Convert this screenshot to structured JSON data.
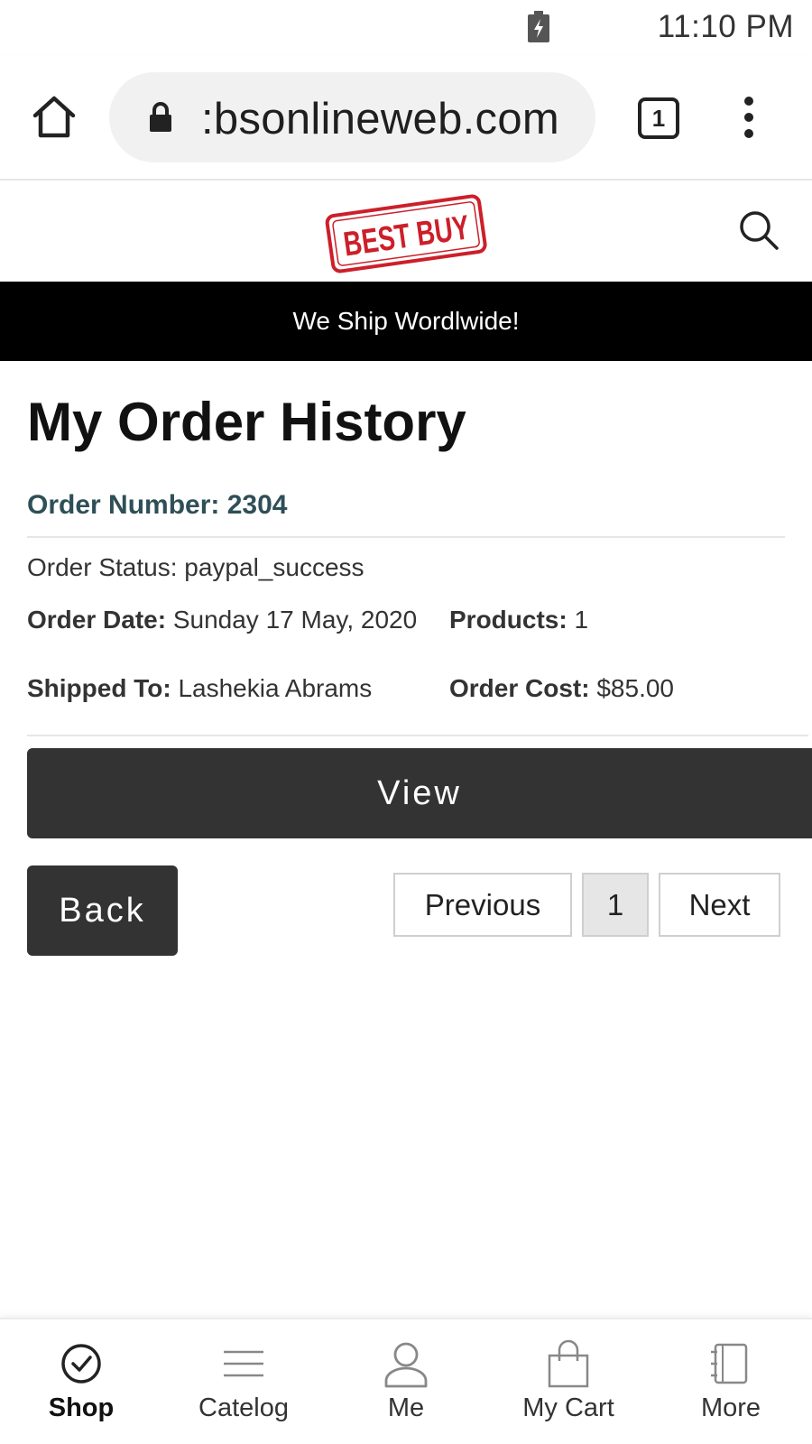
{
  "status_bar": {
    "time": "11:10 PM",
    "battery_icon": "battery-charging-icon"
  },
  "browser": {
    "url": ":bsonlineweb.com",
    "tab_count": "1",
    "icons": {
      "home": "home-icon",
      "lock": "lock-icon",
      "tabs": "tab-switcher-icon",
      "menu": "more-vert-icon"
    }
  },
  "site": {
    "logo_text": "BEST BUY",
    "banner": "We Ship Wordlwide!",
    "search_icon": "search-icon",
    "colors": {
      "banner_bg": "#000000",
      "logo_red": "#cc1f2a",
      "button_bg": "#333333",
      "order_number": "#2f4f57"
    }
  },
  "page": {
    "title": "My Order History",
    "order": {
      "number_label": "Order Number: 2304",
      "status": "Order Status: paypal_success",
      "date_label": "Order Date:",
      "date_value": "Sunday 17 May, 2020",
      "products_label": "Products:",
      "products_value": "1",
      "shipped_label": "Shipped To:",
      "shipped_value": "Lashekia Abrams",
      "cost_label": "Order Cost:",
      "cost_value": "$85.00"
    },
    "view_label": "View",
    "back_label": "Back",
    "pagination": {
      "previous": "Previous",
      "current": "1",
      "next": "Next"
    }
  },
  "bottom_nav": [
    {
      "label": "Shop",
      "icon": "check-circle-icon",
      "active": true
    },
    {
      "label": "Catelog",
      "icon": "menu-lines-icon",
      "active": false
    },
    {
      "label": "Me",
      "icon": "user-icon",
      "active": false
    },
    {
      "label": "My Cart",
      "icon": "shopping-bag-icon",
      "active": false
    },
    {
      "label": "More",
      "icon": "notebook-icon",
      "active": false
    }
  ]
}
